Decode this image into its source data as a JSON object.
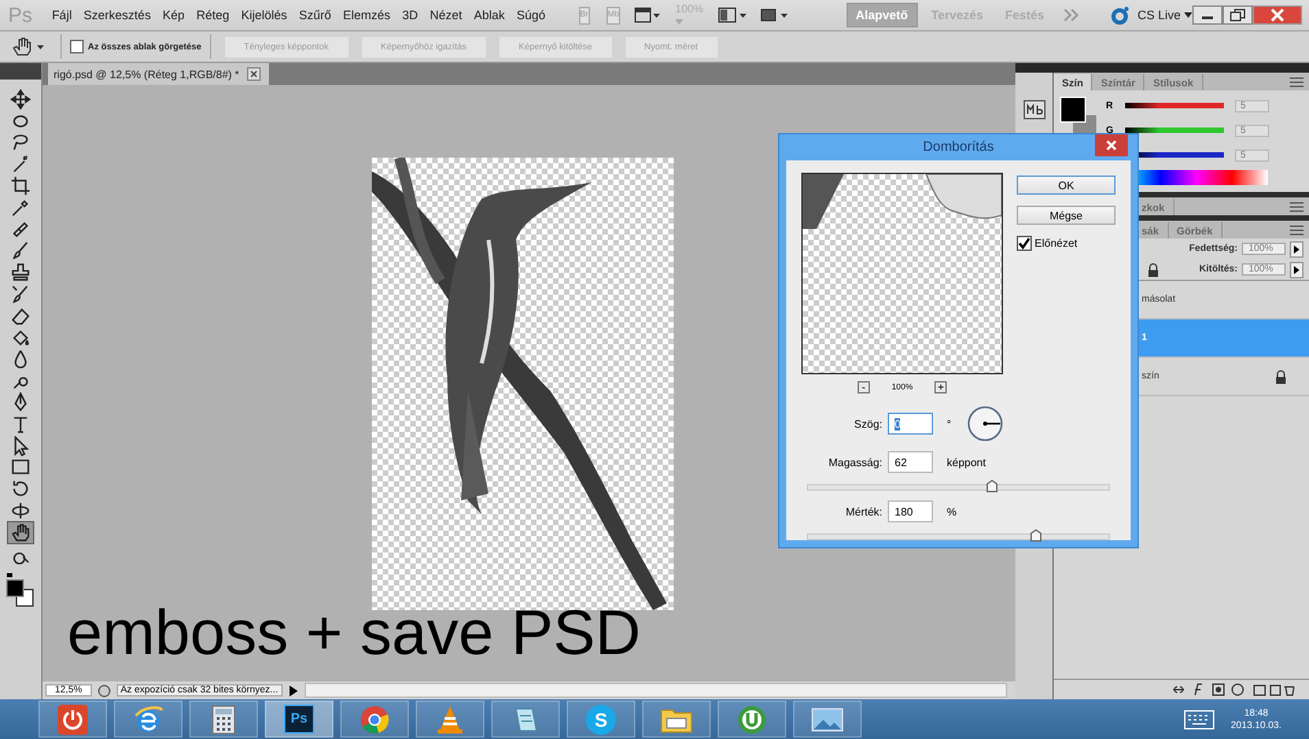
{
  "app_logo": "Ps",
  "menu": [
    "Fájl",
    "Szerkesztés",
    "Kép",
    "Réteg",
    "Kijelölés",
    "Szűrő",
    "Elemzés",
    "3D",
    "Nézet",
    "Ablak",
    "Súgó"
  ],
  "bridge": "Br",
  "mini_bridge": "Mb",
  "zoom_select": "100%",
  "workspaces": [
    {
      "label": "Alapvető",
      "selected": true
    },
    {
      "label": "Tervezés",
      "selected": false
    },
    {
      "label": "Festés",
      "selected": false
    }
  ],
  "cs_live": "CS Live",
  "options_bar": {
    "scroll_all": {
      "label": "Az összes ablak görgetése",
      "checked": false
    },
    "buttons": [
      "Tényleges képpontok",
      "Képernyőhöz igazítás",
      "Képernyő kitöltése",
      "Nyomt. méret"
    ]
  },
  "tools": [
    {
      "kind": "move",
      "selected": false
    },
    {
      "kind": "marquee",
      "selected": false
    },
    {
      "kind": "lasso",
      "selected": false
    },
    {
      "kind": "wand",
      "selected": false
    },
    {
      "kind": "crop",
      "selected": false
    },
    {
      "kind": "eyedropper",
      "selected": false
    },
    {
      "kind": "heal",
      "selected": false
    },
    {
      "kind": "brush",
      "selected": false
    },
    {
      "kind": "stamp",
      "selected": false
    },
    {
      "kind": "history",
      "selected": false
    },
    {
      "kind": "eraser",
      "selected": false
    },
    {
      "kind": "bucket",
      "selected": false
    },
    {
      "kind": "blur",
      "selected": false
    },
    {
      "kind": "dodge",
      "selected": false
    },
    {
      "kind": "pen",
      "selected": false
    },
    {
      "kind": "type",
      "selected": false
    },
    {
      "kind": "pointer",
      "selected": false
    },
    {
      "kind": "shape",
      "selected": false
    },
    {
      "kind": "rotate",
      "selected": false
    },
    {
      "kind": "orbit",
      "selected": false
    },
    {
      "kind": "hand",
      "selected": true
    },
    {
      "kind": "zoom",
      "selected": false
    }
  ],
  "document_tab": {
    "title": "rigó.psd @ 12,5% (Réteg 1,RGB/8#) *"
  },
  "caption": "emboss + save PSD",
  "status_bar": {
    "zoom": "12,5%",
    "message": "Az expozíció csak 32 bites környez..."
  },
  "color_panel": {
    "tabs": [
      {
        "label": "Szín",
        "selected": true
      },
      {
        "label": "Színtár",
        "selected": false
      },
      {
        "label": "Stílusok",
        "selected": false
      }
    ],
    "channels": [
      {
        "name": "R",
        "value": "5",
        "color": "#e02828"
      },
      {
        "name": "G",
        "value": "5",
        "color": "#2ec82e"
      },
      {
        "value": "5",
        "color": "#1a28c8"
      }
    ]
  },
  "adjust_tab": "zkok",
  "layers_tabs": [
    "sák",
    "Görbék"
  ],
  "opacity": {
    "label": "Fedettség:",
    "value": "100%"
  },
  "fill": {
    "label": "Kitöltés:",
    "value": "100%"
  },
  "layers": [
    {
      "name": "másolat",
      "selected": false,
      "locked": false
    },
    {
      "name": "1",
      "selected": true,
      "locked": false
    },
    {
      "name": "szín",
      "selected": false,
      "locked": true
    }
  ],
  "dialog": {
    "title": "Domborítás",
    "ok": "OK",
    "cancel": "Mégse",
    "preview": {
      "label": "Előnézet",
      "checked": true
    },
    "zoom_out": "-",
    "zoom": "100%",
    "zoom_in": "+",
    "angle": {
      "label": "Szög:",
      "value": "0",
      "unit": "°"
    },
    "height": {
      "label": "Magasság:",
      "value": "62",
      "unit": "képpont",
      "level": 0.61
    },
    "amount": {
      "label": "Mérték:",
      "value": "180",
      "unit": "%",
      "level": 0.76
    }
  },
  "taskbar": {
    "apps": [
      {
        "kind": "power",
        "selected": false
      },
      {
        "kind": "globe",
        "selected": false
      },
      {
        "kind": "calculator",
        "selected": false
      },
      {
        "kind": "ps",
        "label": "Ps",
        "selected": true
      },
      {
        "kind": "chrome",
        "selected": false
      },
      {
        "kind": "cone",
        "selected": false
      },
      {
        "kind": "notepad",
        "selected": false
      },
      {
        "kind": "skype",
        "label": "S",
        "selected": false
      },
      {
        "kind": "folder",
        "selected": false
      },
      {
        "kind": "torrent",
        "selected": false
      },
      {
        "kind": "photo",
        "selected": false
      }
    ],
    "time": "18:48",
    "date": "2013.10.03."
  }
}
